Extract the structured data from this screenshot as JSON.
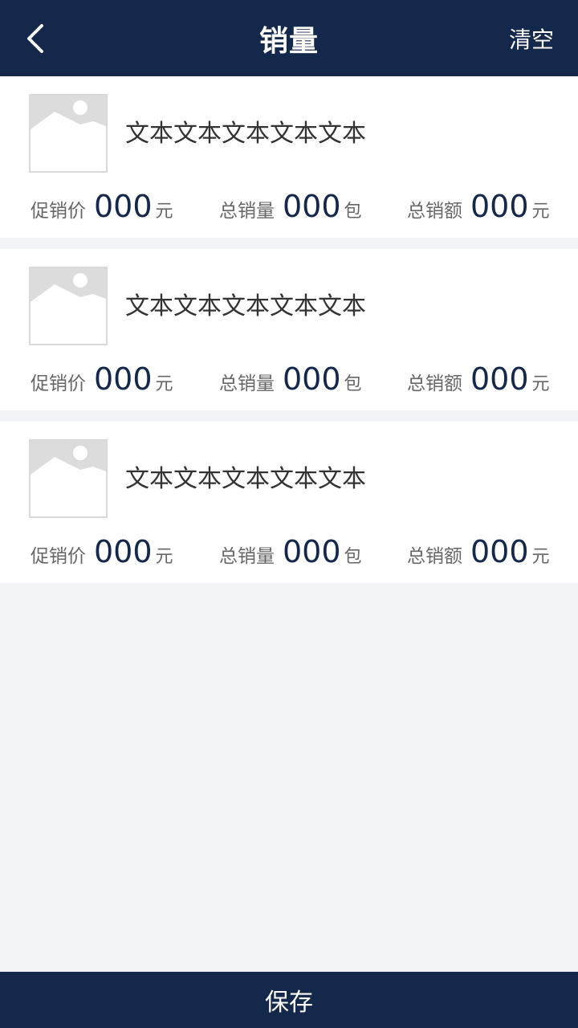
{
  "header": {
    "title": "销量",
    "clear_label": "清空",
    "back_icon": "chevron-left-icon"
  },
  "items": [
    {
      "title": "文本文本文本文本文本",
      "promo_price_label": "促销价",
      "promo_price_value": "000",
      "promo_price_unit": "元",
      "total_qty_label": "总销量",
      "total_qty_value": "000",
      "total_qty_unit": "包",
      "total_amount_label": "总销额",
      "total_amount_value": "000",
      "total_amount_unit": "元"
    },
    {
      "title": "文本文本文本文本文本",
      "promo_price_label": "促销价",
      "promo_price_value": "000",
      "promo_price_unit": "元",
      "total_qty_label": "总销量",
      "total_qty_value": "000",
      "total_qty_unit": "包",
      "total_amount_label": "总销额",
      "total_amount_value": "000",
      "total_amount_unit": "元"
    },
    {
      "title": "文本文本文本文本文本",
      "promo_price_label": "促销价",
      "promo_price_value": "000",
      "promo_price_unit": "元",
      "total_qty_label": "总销量",
      "total_qty_value": "000",
      "total_qty_unit": "包",
      "total_amount_label": "总销额",
      "total_amount_value": "000",
      "total_amount_unit": "元"
    }
  ],
  "footer": {
    "save_label": "保存"
  },
  "colors": {
    "primary": "#13284a",
    "background": "#f2f3f7",
    "card": "#ffffff",
    "label_text": "#666666",
    "title_text": "#333333",
    "placeholder": "#dcdcdc"
  }
}
